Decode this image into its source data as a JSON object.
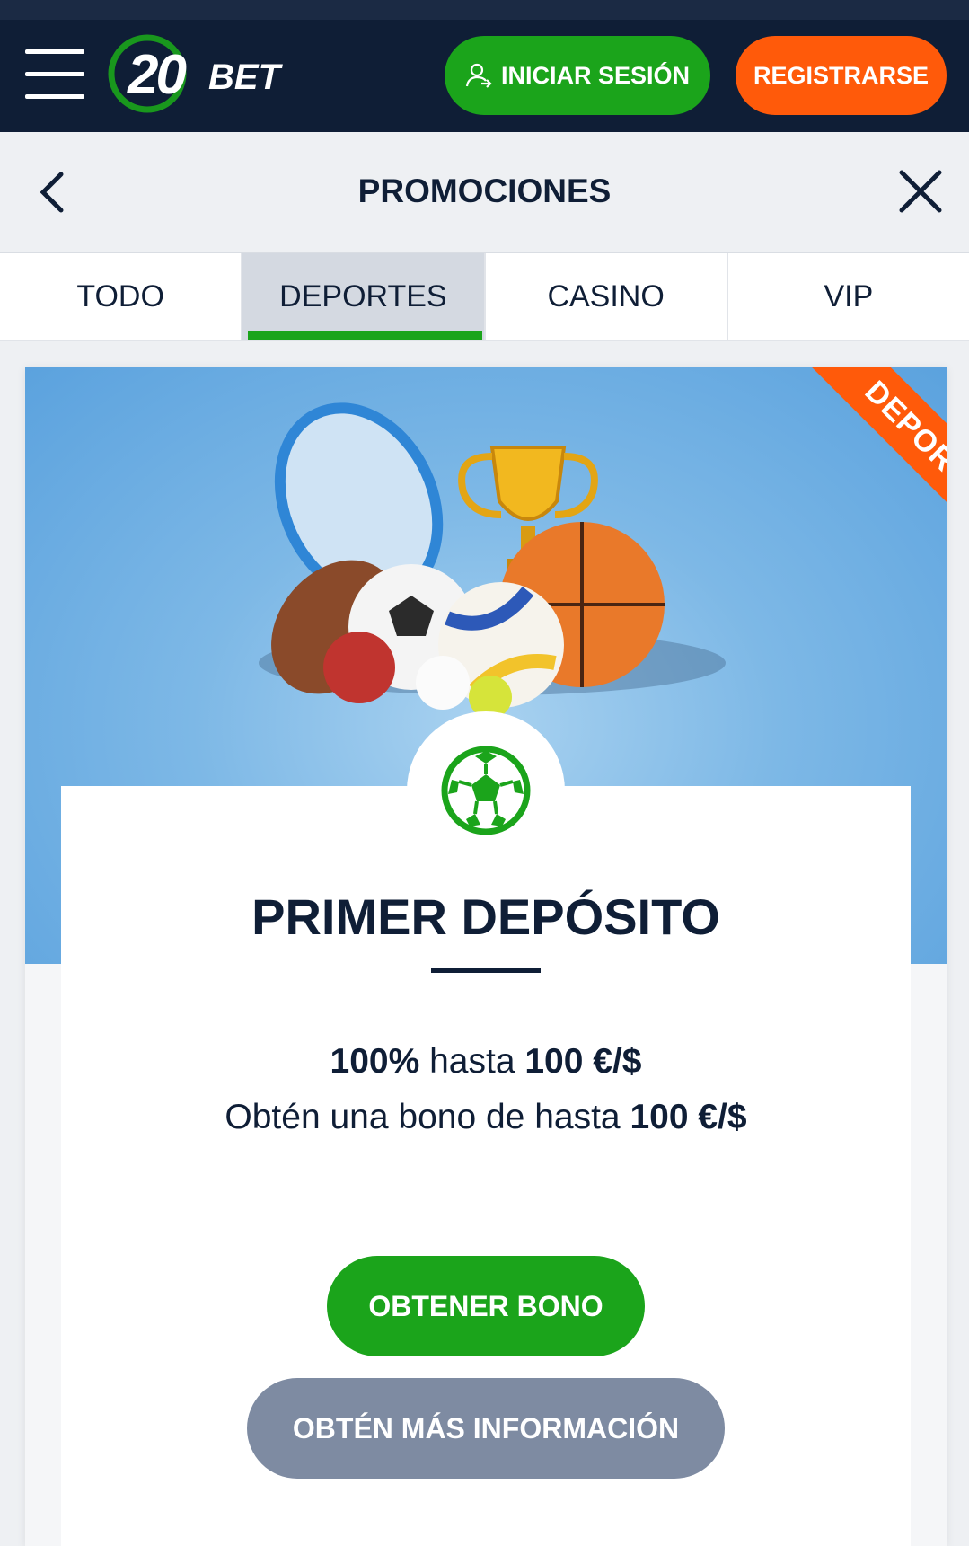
{
  "header": {
    "logo_number": "20",
    "logo_text": "BET",
    "login_label": "INICIAR SESIÓN",
    "register_label": "REGISTRARSE"
  },
  "page": {
    "title": "PROMOCIONES"
  },
  "tabs": [
    {
      "label": "TODO",
      "active": false
    },
    {
      "label": "DEPORTES",
      "active": true
    },
    {
      "label": "CASINO",
      "active": false
    },
    {
      "label": "VIP",
      "active": false
    }
  ],
  "promo": {
    "ribbon": "DEPORTES",
    "title": "PRIMER DEPÓSITO",
    "line1_a": "100%",
    "line1_b": " hasta ",
    "line1_c": "100 €/$",
    "line2_a": "Obtén una bono de hasta ",
    "line2_b": "100 €/$",
    "cta_primary": "OBTENER BONO",
    "cta_secondary": "OBTÉN MÁS INFORMACIÓN"
  },
  "colors": {
    "navy": "#0f1e36",
    "green": "#1ba41b",
    "orange": "#ff5a0a",
    "grey_button": "#7e8ba2"
  }
}
